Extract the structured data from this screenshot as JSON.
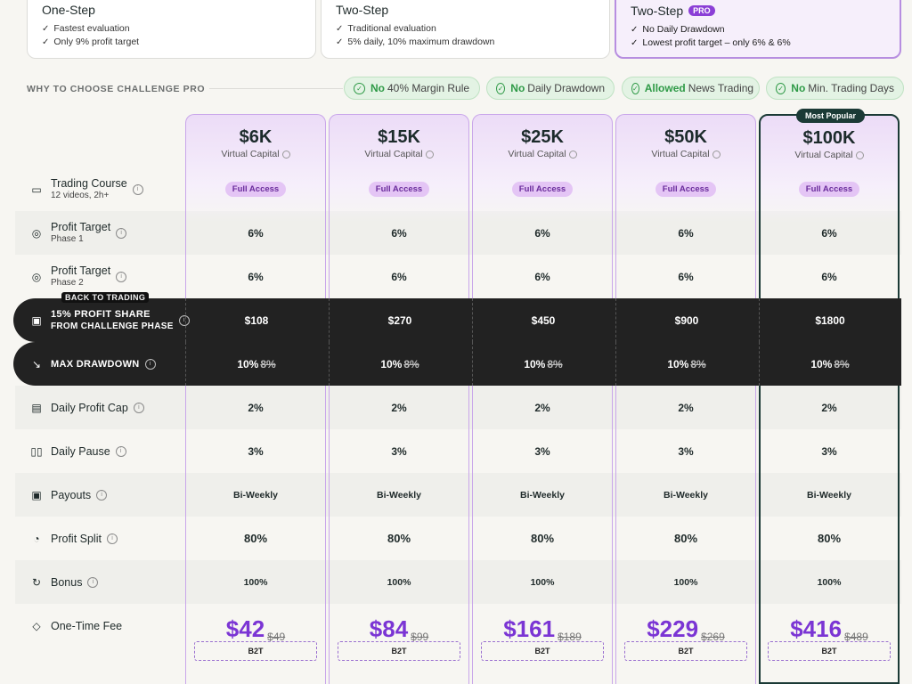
{
  "top_cards": [
    {
      "title": "One-Step",
      "items": [
        "Fastest evaluation",
        "Only 9% profit target"
      ]
    },
    {
      "title": "Two-Step",
      "items": [
        "Traditional evaluation",
        "5% daily, 10% maximum drawdown"
      ]
    },
    {
      "title": "Two-Step",
      "badge": "PRO",
      "items": [
        "No Daily Drawdown",
        "Lowest profit target – only 6% & 6%"
      ]
    }
  ],
  "why": {
    "label": "WHY TO CHOOSE CHALLENGE PRO",
    "pills": [
      {
        "hl": "No",
        "text": "40% Margin Rule"
      },
      {
        "hl": "No",
        "text": "Daily Drawdown"
      },
      {
        "hl": "Allowed",
        "text": "News Trading"
      },
      {
        "hl": "No",
        "text": "Min. Trading Days"
      }
    ]
  },
  "plans": [
    {
      "price": "$6K",
      "caption": "Virtual Capital"
    },
    {
      "price": "$15K",
      "caption": "Virtual Capital"
    },
    {
      "price": "$25K",
      "caption": "Virtual Capital"
    },
    {
      "price": "$50K",
      "caption": "Virtual Capital"
    },
    {
      "price": "$100K",
      "caption": "Virtual Capital"
    }
  ],
  "popular_badge": "Most Popular",
  "back_to_trading": "BACK TO TRADING",
  "full_access": "Full Access",
  "rows": {
    "course": {
      "label": "Trading Course",
      "sub": "12 videos, 2h+"
    },
    "pt1": {
      "label": "Profit Target",
      "sub": "Phase 1",
      "values": [
        "6%",
        "6%",
        "6%",
        "6%",
        "6%"
      ]
    },
    "pt2": {
      "label": "Profit Target",
      "sub": "Phase 2",
      "values": [
        "6%",
        "6%",
        "6%",
        "6%",
        "6%"
      ]
    },
    "share": {
      "label": "15% Profit Share",
      "sub": "from challenge phase",
      "values": [
        "$108",
        "$270",
        "$450",
        "$900",
        "$1800"
      ]
    },
    "mdd": {
      "label": "Max Drawdown",
      "new": "10%",
      "old": "8%"
    },
    "dpc": {
      "label": "Daily Profit Cap",
      "values": [
        "2%",
        "2%",
        "2%",
        "2%",
        "2%"
      ]
    },
    "dp": {
      "label": "Daily Pause",
      "values": [
        "3%",
        "3%",
        "3%",
        "3%",
        "3%"
      ]
    },
    "pay": {
      "label": "Payouts",
      "values": [
        "Bi-Weekly",
        "Bi-Weekly",
        "Bi-Weekly",
        "Bi-Weekly",
        "Bi-Weekly"
      ]
    },
    "split": {
      "label": "Profit Split",
      "values": [
        "80%",
        "80%",
        "80%",
        "80%",
        "80%"
      ]
    },
    "bonus": {
      "label": "Bonus",
      "values": [
        "100%",
        "100%",
        "100%",
        "100%",
        "100%"
      ]
    },
    "fee": {
      "label": "One-Time Fee",
      "prices": [
        "$42",
        "$84",
        "$161",
        "$229",
        "$416"
      ],
      "old": [
        "$49",
        "$99",
        "$189",
        "$269",
        "$489"
      ],
      "code": "B2T"
    }
  }
}
